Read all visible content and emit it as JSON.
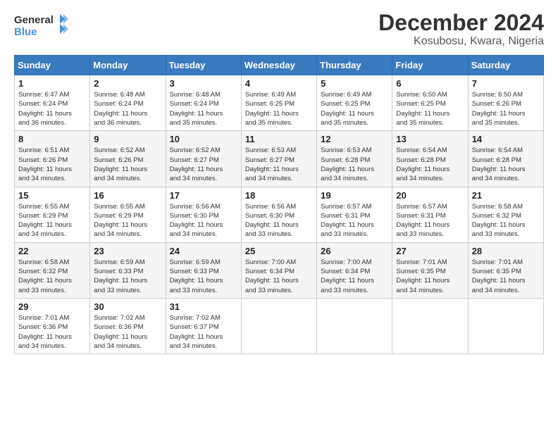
{
  "logo": {
    "line1": "General",
    "line2": "Blue"
  },
  "title": "December 2024",
  "subtitle": "Kosubosu, Kwara, Nigeria",
  "days_header": [
    "Sunday",
    "Monday",
    "Tuesday",
    "Wednesday",
    "Thursday",
    "Friday",
    "Saturday"
  ],
  "weeks": [
    [
      {
        "day": "1",
        "info": "Sunrise: 6:47 AM\nSunset: 6:24 PM\nDaylight: 11 hours\nand 36 minutes."
      },
      {
        "day": "2",
        "info": "Sunrise: 6:48 AM\nSunset: 6:24 PM\nDaylight: 11 hours\nand 36 minutes."
      },
      {
        "day": "3",
        "info": "Sunrise: 6:48 AM\nSunset: 6:24 PM\nDaylight: 11 hours\nand 35 minutes."
      },
      {
        "day": "4",
        "info": "Sunrise: 6:49 AM\nSunset: 6:25 PM\nDaylight: 11 hours\nand 35 minutes."
      },
      {
        "day": "5",
        "info": "Sunrise: 6:49 AM\nSunset: 6:25 PM\nDaylight: 11 hours\nand 35 minutes."
      },
      {
        "day": "6",
        "info": "Sunrise: 6:50 AM\nSunset: 6:25 PM\nDaylight: 11 hours\nand 35 minutes."
      },
      {
        "day": "7",
        "info": "Sunrise: 6:50 AM\nSunset: 6:26 PM\nDaylight: 11 hours\nand 35 minutes."
      }
    ],
    [
      {
        "day": "8",
        "info": "Sunrise: 6:51 AM\nSunset: 6:26 PM\nDaylight: 11 hours\nand 34 minutes."
      },
      {
        "day": "9",
        "info": "Sunrise: 6:52 AM\nSunset: 6:26 PM\nDaylight: 11 hours\nand 34 minutes."
      },
      {
        "day": "10",
        "info": "Sunrise: 6:52 AM\nSunset: 6:27 PM\nDaylight: 11 hours\nand 34 minutes."
      },
      {
        "day": "11",
        "info": "Sunrise: 6:53 AM\nSunset: 6:27 PM\nDaylight: 11 hours\nand 34 minutes."
      },
      {
        "day": "12",
        "info": "Sunrise: 6:53 AM\nSunset: 6:28 PM\nDaylight: 11 hours\nand 34 minutes."
      },
      {
        "day": "13",
        "info": "Sunrise: 6:54 AM\nSunset: 6:28 PM\nDaylight: 11 hours\nand 34 minutes."
      },
      {
        "day": "14",
        "info": "Sunrise: 6:54 AM\nSunset: 6:28 PM\nDaylight: 11 hours\nand 34 minutes."
      }
    ],
    [
      {
        "day": "15",
        "info": "Sunrise: 6:55 AM\nSunset: 6:29 PM\nDaylight: 11 hours\nand 34 minutes."
      },
      {
        "day": "16",
        "info": "Sunrise: 6:55 AM\nSunset: 6:29 PM\nDaylight: 11 hours\nand 34 minutes."
      },
      {
        "day": "17",
        "info": "Sunrise: 6:56 AM\nSunset: 6:30 PM\nDaylight: 11 hours\nand 34 minutes."
      },
      {
        "day": "18",
        "info": "Sunrise: 6:56 AM\nSunset: 6:30 PM\nDaylight: 11 hours\nand 33 minutes."
      },
      {
        "day": "19",
        "info": "Sunrise: 6:57 AM\nSunset: 6:31 PM\nDaylight: 11 hours\nand 33 minutes."
      },
      {
        "day": "20",
        "info": "Sunrise: 6:57 AM\nSunset: 6:31 PM\nDaylight: 11 hours\nand 33 minutes."
      },
      {
        "day": "21",
        "info": "Sunrise: 6:58 AM\nSunset: 6:32 PM\nDaylight: 11 hours\nand 33 minutes."
      }
    ],
    [
      {
        "day": "22",
        "info": "Sunrise: 6:58 AM\nSunset: 6:32 PM\nDaylight: 11 hours\nand 33 minutes."
      },
      {
        "day": "23",
        "info": "Sunrise: 6:59 AM\nSunset: 6:33 PM\nDaylight: 11 hours\nand 33 minutes."
      },
      {
        "day": "24",
        "info": "Sunrise: 6:59 AM\nSunset: 6:33 PM\nDaylight: 11 hours\nand 33 minutes."
      },
      {
        "day": "25",
        "info": "Sunrise: 7:00 AM\nSunset: 6:34 PM\nDaylight: 11 hours\nand 33 minutes."
      },
      {
        "day": "26",
        "info": "Sunrise: 7:00 AM\nSunset: 6:34 PM\nDaylight: 11 hours\nand 33 minutes."
      },
      {
        "day": "27",
        "info": "Sunrise: 7:01 AM\nSunset: 6:35 PM\nDaylight: 11 hours\nand 34 minutes."
      },
      {
        "day": "28",
        "info": "Sunrise: 7:01 AM\nSunset: 6:35 PM\nDaylight: 11 hours\nand 34 minutes."
      }
    ],
    [
      {
        "day": "29",
        "info": "Sunrise: 7:01 AM\nSunset: 6:36 PM\nDaylight: 11 hours\nand 34 minutes."
      },
      {
        "day": "30",
        "info": "Sunrise: 7:02 AM\nSunset: 6:36 PM\nDaylight: 11 hours\nand 34 minutes."
      },
      {
        "day": "31",
        "info": "Sunrise: 7:02 AM\nSunset: 6:37 PM\nDaylight: 11 hours\nand 34 minutes."
      },
      null,
      null,
      null,
      null
    ]
  ]
}
